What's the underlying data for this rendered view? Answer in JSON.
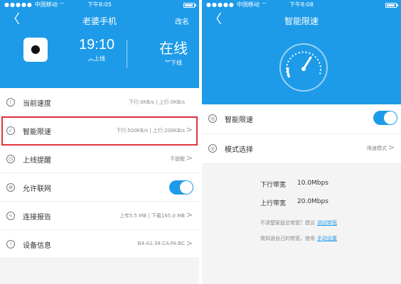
{
  "left": {
    "status": {
      "carrier": "中国移动",
      "time": "下午8:05"
    },
    "nav": {
      "back": "〈",
      "title": "老婆手机",
      "rename": "改名"
    },
    "hero": {
      "time": "19:10",
      "time_caption": "上线",
      "state": "在线",
      "state_caption": "下线"
    },
    "items": [
      {
        "label": "当前速度",
        "value": "下行:0KB/s | 上行:0KB/s"
      },
      {
        "label": "智能限速",
        "value": "下行:500KB/s | 上行:200KB/s"
      },
      {
        "label": "上线提醒",
        "value": "不提醒"
      },
      {
        "label": "允许联网",
        "value": ""
      },
      {
        "label": "连接报告",
        "value": "上传5.5 MB | 下载165.0 MB"
      },
      {
        "label": "设备信息",
        "value": "B4:A1:34:CA:FA:BC"
      }
    ]
  },
  "right": {
    "status": {
      "carrier": "中国移动",
      "time": "下午8:08"
    },
    "nav": {
      "back": "〈",
      "title": "智能限速"
    },
    "items": [
      {
        "label": "智能限速",
        "value": ""
      },
      {
        "label": "模式选择",
        "value": "限速模式"
      }
    ],
    "bandwidth": {
      "down_label": "下行带宽",
      "down_value": "10.0Mbps",
      "up_label": "上行带宽",
      "up_value": "20.0Mbps",
      "hint1": "不清楚家庭总带宽？建议",
      "hint1_link": "测试带宽",
      "hint2": "我知道自己的带宽，使用",
      "hint2_link": "手动设置"
    }
  },
  "colors": {
    "accent": "#1d9be8",
    "highlight": "#e0353d"
  }
}
